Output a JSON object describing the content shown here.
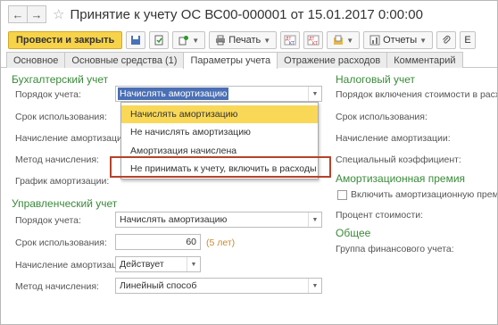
{
  "window": {
    "title": "Принятие к учету ОС ВС00-000001 от 15.01.2017 0:00:00"
  },
  "nav": {
    "back_glyph": "←",
    "forward_glyph": "→",
    "star_glyph": "☆"
  },
  "toolbar": {
    "post_close": "Провести и закрыть",
    "print": "Печать",
    "reports": "Отчеты"
  },
  "tabs": [
    "Основное",
    "Основные средства (1)",
    "Параметры учета",
    "Отражение расходов",
    "Комментарий"
  ],
  "accounting": {
    "header": "Бухгалтерский учет",
    "order_label": "Порядок учета:",
    "order_value": "Начислять амортизацию",
    "term_label": "Срок использования:",
    "depr_label": "Начисление амортизации:",
    "method_label": "Метод начисления:",
    "schedule_label": "График амортизации:"
  },
  "dropdown": {
    "options": [
      "Начислять амортизацию",
      "Не начислять амортизацию",
      "Амортизация начислена",
      "Не принимать к учету, включить в расходы"
    ]
  },
  "management": {
    "header": "Управленческий учет",
    "order_label": "Порядок учета:",
    "order_value": "Начислять амортизацию",
    "term_label": "Срок использования:",
    "term_value": "60",
    "term_hint": "(5 лет)",
    "depr_label": "Начисление амортизации:",
    "depr_value": "Действует",
    "method_label": "Метод начисления:",
    "method_value": "Линейный способ"
  },
  "tax": {
    "header": "Налоговый учет",
    "cost_label": "Порядок включения стоимости в расходы:",
    "term_label": "Срок использования:",
    "depr_label": "Начисление амортизации:",
    "coef_label": "Специальный коэффициент:"
  },
  "premium": {
    "header": "Амортизационная премия",
    "checkbox_label": "Включить амортизационную премию в",
    "percent_label": "Процент стоимости:"
  },
  "general": {
    "header": "Общее",
    "group_label": "Группа финансового учета:"
  }
}
